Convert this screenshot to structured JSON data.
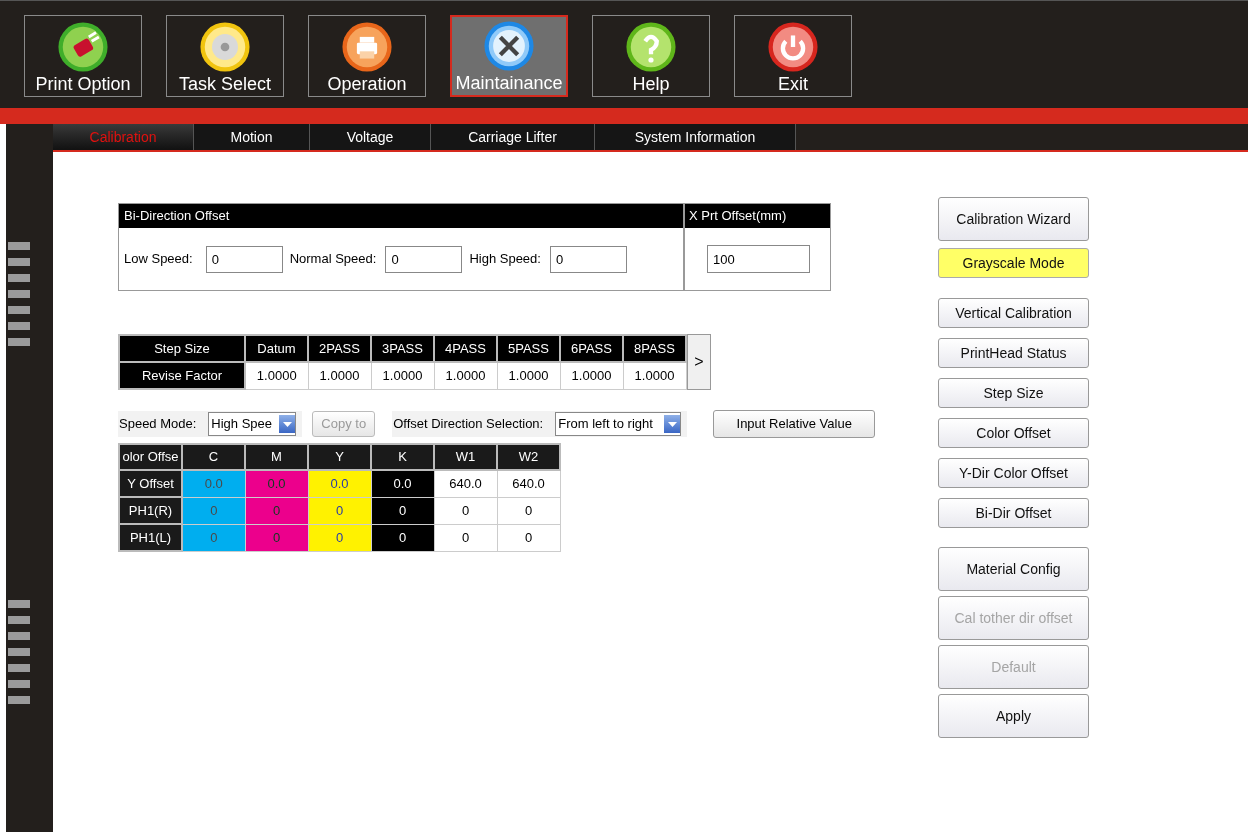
{
  "toolbar": [
    {
      "label": "Print Option",
      "selected": false
    },
    {
      "label": "Task Select",
      "selected": false
    },
    {
      "label": "Operation",
      "selected": false
    },
    {
      "label": "Maintainance",
      "selected": true
    },
    {
      "label": "Help",
      "selected": false
    },
    {
      "label": "Exit",
      "selected": false
    }
  ],
  "tabs": [
    {
      "label": "Calibration",
      "selected": true
    },
    {
      "label": "Motion",
      "selected": false
    },
    {
      "label": "Voltage",
      "selected": false
    },
    {
      "label": "Carriage Lifter",
      "selected": false
    },
    {
      "label": "System Information",
      "selected": false
    }
  ],
  "bi_direction_offset": {
    "title": "Bi-Direction Offset",
    "fields": [
      {
        "label": "Low Speed:",
        "value": "0"
      },
      {
        "label": "Normal Speed:",
        "value": "0"
      },
      {
        "label": "High Speed:",
        "value": "0"
      }
    ]
  },
  "x_prt_offset": {
    "title": "X Prt Offset(mm)",
    "value": "100"
  },
  "step_table": {
    "row_headers": [
      "Step Size",
      "Revise Factor"
    ],
    "columns": [
      "Datum",
      "2PASS",
      "3PASS",
      "4PASS",
      "5PASS",
      "6PASS",
      "8PASS"
    ],
    "values": [
      "1.0000",
      "1.0000",
      "1.0000",
      "1.0000",
      "1.0000",
      "1.0000",
      "1.0000"
    ],
    "next": ">"
  },
  "speed_mode": {
    "label": "Speed Mode:",
    "value": "High Spee"
  },
  "copy_button": {
    "label": "Copy to",
    "disabled": true
  },
  "offset_direction": {
    "label": "Offset Direction Selection:",
    "value": "From left to right"
  },
  "input_relative_button": {
    "label": "Input Relative Value"
  },
  "color_table": {
    "corner": "olor Offse",
    "columns": [
      {
        "label": "C",
        "color": "#00aeef"
      },
      {
        "label": "M",
        "color": "#ec008c"
      },
      {
        "label": "Y",
        "color": "#fff200"
      },
      {
        "label": "K",
        "color": "#000000"
      },
      {
        "label": "W1",
        "color": "#ffffff"
      },
      {
        "label": "W2",
        "color": "#ffffff"
      }
    ],
    "rows": [
      {
        "label": "Y Offset",
        "cells": [
          "0.0",
          "0.0",
          "0.0",
          "0.0",
          "640.0",
          "640.0"
        ]
      },
      {
        "label": "PH1(R)",
        "cells": [
          "0",
          "0",
          "0",
          "0",
          "0",
          "0"
        ]
      },
      {
        "label": "PH1(L)",
        "cells": [
          "0",
          "0",
          "0",
          "0",
          "0",
          "0"
        ]
      }
    ]
  },
  "side_buttons": [
    [
      {
        "label": "Calibration Wizard",
        "kind": "large",
        "highlighted": false,
        "disabled": false
      },
      {
        "label": "Grayscale Mode",
        "kind": "small",
        "highlighted": true,
        "disabled": false
      }
    ],
    [
      {
        "label": "Vertical Calibration",
        "kind": "small",
        "highlighted": false,
        "disabled": false
      },
      {
        "label": "PrintHead Status",
        "kind": "small",
        "highlighted": false,
        "disabled": false
      },
      {
        "label": "Step Size",
        "kind": "small",
        "highlighted": false,
        "disabled": false
      },
      {
        "label": "Color Offset",
        "kind": "small",
        "highlighted": false,
        "disabled": false
      },
      {
        "label": "Y-Dir Color Offset",
        "kind": "small",
        "highlighted": false,
        "disabled": false
      },
      {
        "label": "Bi-Dir Offset",
        "kind": "small",
        "highlighted": false,
        "disabled": false
      }
    ],
    [
      {
        "label": "Material Config",
        "kind": "large",
        "highlighted": false,
        "disabled": false
      },
      {
        "label": "Cal tother dir offset",
        "kind": "large",
        "highlighted": false,
        "disabled": true
      },
      {
        "label": "Default",
        "kind": "large",
        "highlighted": false,
        "disabled": true
      },
      {
        "label": "Apply",
        "kind": "large",
        "highlighted": false,
        "disabled": false
      }
    ]
  ]
}
